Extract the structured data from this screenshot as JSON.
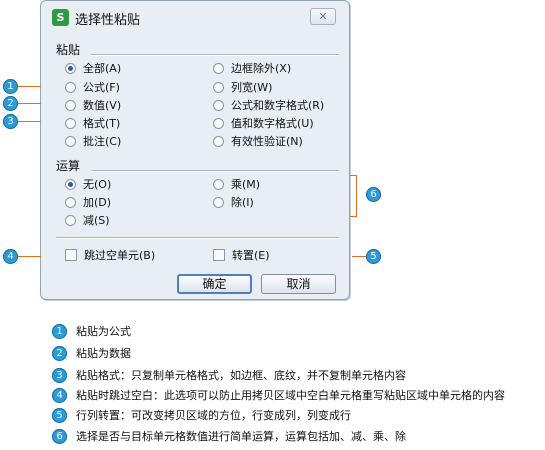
{
  "dialog": {
    "title": "选择性粘贴",
    "app_icon": "S",
    "close_label": "✕",
    "paste_group": {
      "label": "粘贴",
      "left": [
        "全部(A)",
        "公式(F)",
        "数值(V)",
        "格式(T)",
        "批注(C)"
      ],
      "right": [
        "边框除外(X)",
        "列宽(W)",
        "公式和数字格式(R)",
        "值和数字格式(U)",
        "有效性验证(N)"
      ],
      "selected": "全部(A)"
    },
    "operation_group": {
      "label": "运算",
      "left": [
        "无(O)",
        "加(D)",
        "减(S)"
      ],
      "right": [
        "乘(M)",
        "除(I)"
      ],
      "selected": "无(O)"
    },
    "skip_blanks_label": "跳过空单元(B)",
    "transpose_label": "转置(E)",
    "ok_label": "确定",
    "cancel_label": "取消"
  },
  "callouts": [
    "1",
    "2",
    "3",
    "4",
    "5",
    "6"
  ],
  "notes": [
    {
      "num": "1",
      "text": "粘贴为公式"
    },
    {
      "num": "2",
      "text": "粘贴为数据"
    },
    {
      "num": "3",
      "text": "粘贴格式：只复制单元格格式，如边框、底纹，并不复制单元格内容"
    },
    {
      "num": "4",
      "text": "粘贴时跳过空白：此选项可以防止用拷贝区域中空白单元格重写粘贴区域中单元格的内容"
    },
    {
      "num": "5",
      "text": "行列转置：可改变拷贝区域的方位，行变成列，列变成行"
    },
    {
      "num": "6",
      "text": "选择是否与目标单元格数值进行简单运算，运算包括加、减、乘、除"
    }
  ],
  "colors": {
    "callout": "#2d9bd8",
    "leader": "#e07020",
    "dialog_bg": "#e9eef5"
  }
}
